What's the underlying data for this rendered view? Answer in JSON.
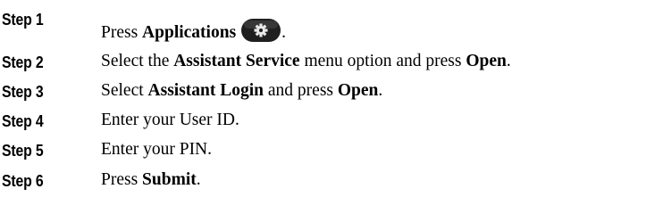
{
  "steps": [
    {
      "label": "Step 1",
      "segments": [
        {
          "text": "Press ",
          "bold": false
        },
        {
          "text": "Applications",
          "bold": true
        },
        {
          "icon": "applications-gear-icon"
        },
        {
          "text": ".",
          "bold": false
        }
      ]
    },
    {
      "label": "Step 2",
      "segments": [
        {
          "text": "Select the ",
          "bold": false
        },
        {
          "text": "Assistant Service",
          "bold": true
        },
        {
          "text": " menu option and press ",
          "bold": false
        },
        {
          "text": "Open",
          "bold": true
        },
        {
          "text": ".",
          "bold": false
        }
      ]
    },
    {
      "label": "Step 3",
      "segments": [
        {
          "text": "Select ",
          "bold": false
        },
        {
          "text": "Assistant Login",
          "bold": true
        },
        {
          "text": " and press ",
          "bold": false
        },
        {
          "text": "Open",
          "bold": true
        },
        {
          "text": ".",
          "bold": false
        }
      ]
    },
    {
      "label": "Step 4",
      "segments": [
        {
          "text": "Enter your User ID.",
          "bold": false
        }
      ]
    },
    {
      "label": "Step 5",
      "segments": [
        {
          "text": "Enter your PIN.",
          "bold": false
        }
      ]
    },
    {
      "label": "Step 6",
      "segments": [
        {
          "text": "Press ",
          "bold": false
        },
        {
          "text": "Submit",
          "bold": true
        },
        {
          "text": ".",
          "bold": false
        }
      ]
    }
  ],
  "colors": {
    "text": "#000000",
    "background": "#ffffff",
    "icon_body": "#1f1f1f",
    "icon_gear": "#e8e8e8"
  }
}
